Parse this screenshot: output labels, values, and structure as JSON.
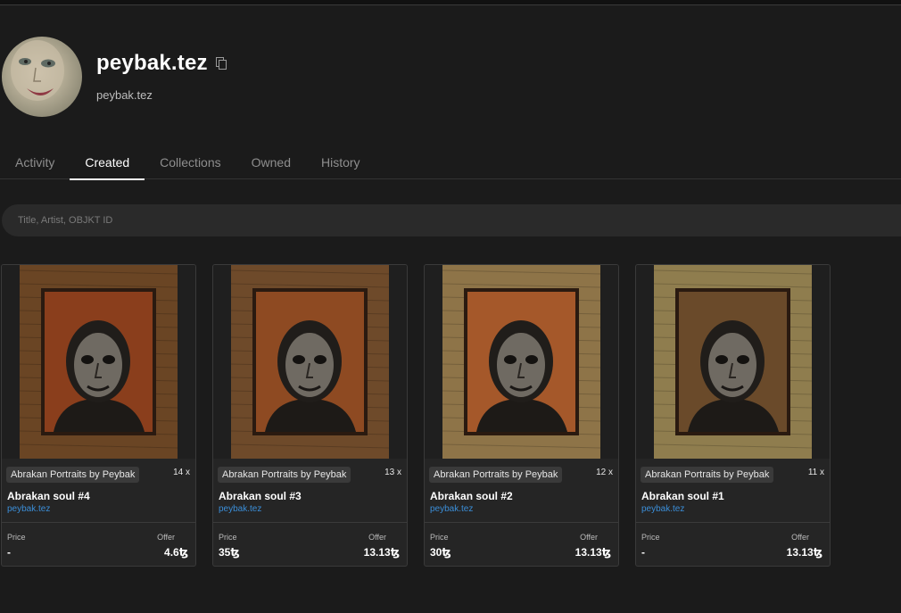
{
  "profile": {
    "name": "peybak.tez",
    "subtitle": "peybak.tez"
  },
  "tabs": [
    {
      "label": "Activity",
      "active": false
    },
    {
      "label": "Created",
      "active": true
    },
    {
      "label": "Collections",
      "active": false
    },
    {
      "label": "Owned",
      "active": false
    },
    {
      "label": "History",
      "active": false
    }
  ],
  "search": {
    "placeholder": "Title, Artist, OBJKT ID"
  },
  "cards": [
    {
      "collection": "Abrakan Portraits by Peybak",
      "editions": "14 x",
      "title": "Abrakan soul #4",
      "artist": "peybak.tez",
      "price_label": "Price",
      "offer_label": "Offer",
      "price": "-",
      "offer": "4.6ꜩ",
      "frame": "#6a4524",
      "canvas": "#8a3e1c"
    },
    {
      "collection": "Abrakan Portraits by Peybak",
      "editions": "13 x",
      "title": "Abrakan soul #3",
      "artist": "peybak.tez",
      "price_label": "Price",
      "offer_label": "Offer",
      "price": "35ꜩ",
      "offer": "13.13ꜩ",
      "frame": "#6e4a2a",
      "canvas": "#8e4a22"
    },
    {
      "collection": "Abrakan Portraits by Peybak",
      "editions": "12 x",
      "title": "Abrakan soul #2",
      "artist": "peybak.tez",
      "price_label": "Price",
      "offer_label": "Offer",
      "price": "30ꜩ",
      "offer": "13.13ꜩ",
      "frame": "#8e7448",
      "canvas": "#a5582a"
    },
    {
      "collection": "Abrakan Portraits by Peybak",
      "editions": "11 x",
      "title": "Abrakan soul #1",
      "artist": "peybak.tez",
      "price_label": "Price",
      "offer_label": "Offer",
      "price": "-",
      "offer": "13.13ꜩ",
      "frame": "#8f7d4e",
      "canvas": "#6a4a2a"
    }
  ],
  "colors": {
    "background": "#1b1b1b",
    "card": "#252525",
    "accent_link": "#3b8ed8"
  }
}
